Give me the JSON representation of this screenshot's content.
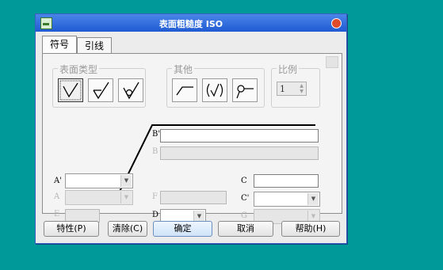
{
  "window": {
    "title": "表面粗糙度 ISO"
  },
  "tabs": [
    {
      "label": "符号",
      "active": true
    },
    {
      "label": "引线",
      "active": false
    }
  ],
  "groups": {
    "surface_type": {
      "label": "表面类型",
      "buttons": [
        "basic-symbol-icon",
        "material-removal-required-icon",
        "material-removal-prohibited-icon"
      ],
      "selected": 0
    },
    "other": {
      "label": "其他",
      "buttons": [
        "leader-line-icon",
        "all-around-icon",
        "pointer-circle-icon"
      ]
    },
    "scale": {
      "label": "比例",
      "value": "1"
    }
  },
  "fields": {
    "b_prime": {
      "label": "B'",
      "value": ""
    },
    "b": {
      "label": "B",
      "value": ""
    },
    "a_prime": {
      "label": "A'",
      "value": ""
    },
    "a": {
      "label": "A",
      "value": ""
    },
    "e": {
      "label": "E",
      "value": ""
    },
    "f": {
      "label": "F",
      "value": ""
    },
    "d": {
      "label": "D",
      "value": ""
    },
    "c": {
      "label": "C",
      "value": ""
    },
    "c_prime": {
      "label": "C'",
      "value": ""
    },
    "g": {
      "label": "G",
      "value": ""
    }
  },
  "buttons": {
    "properties": "特性(P)",
    "clear": "清除(C)",
    "ok": "确定",
    "cancel": "取消",
    "help": "帮助(H)"
  },
  "colors": {
    "desktop": "#009999",
    "titlebar": "#1f5ad3",
    "close": "#e04b2b"
  }
}
